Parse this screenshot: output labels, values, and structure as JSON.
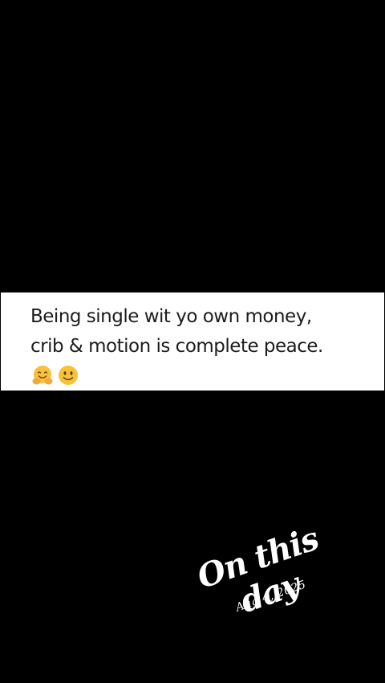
{
  "post": {
    "line1": "Being single wit yo own money,",
    "line2": "crib & motion is complete peace.",
    "emojis": [
      "hugging-face-icon",
      "smiling-face-icon"
    ]
  },
  "sticker": {
    "title": "On this day",
    "date": "Aug 4, 2025"
  },
  "colors": {
    "background": "#000000",
    "card": "#ffffff",
    "text": "#1c1c1e",
    "emoji_yellow": "#f7c23a"
  }
}
